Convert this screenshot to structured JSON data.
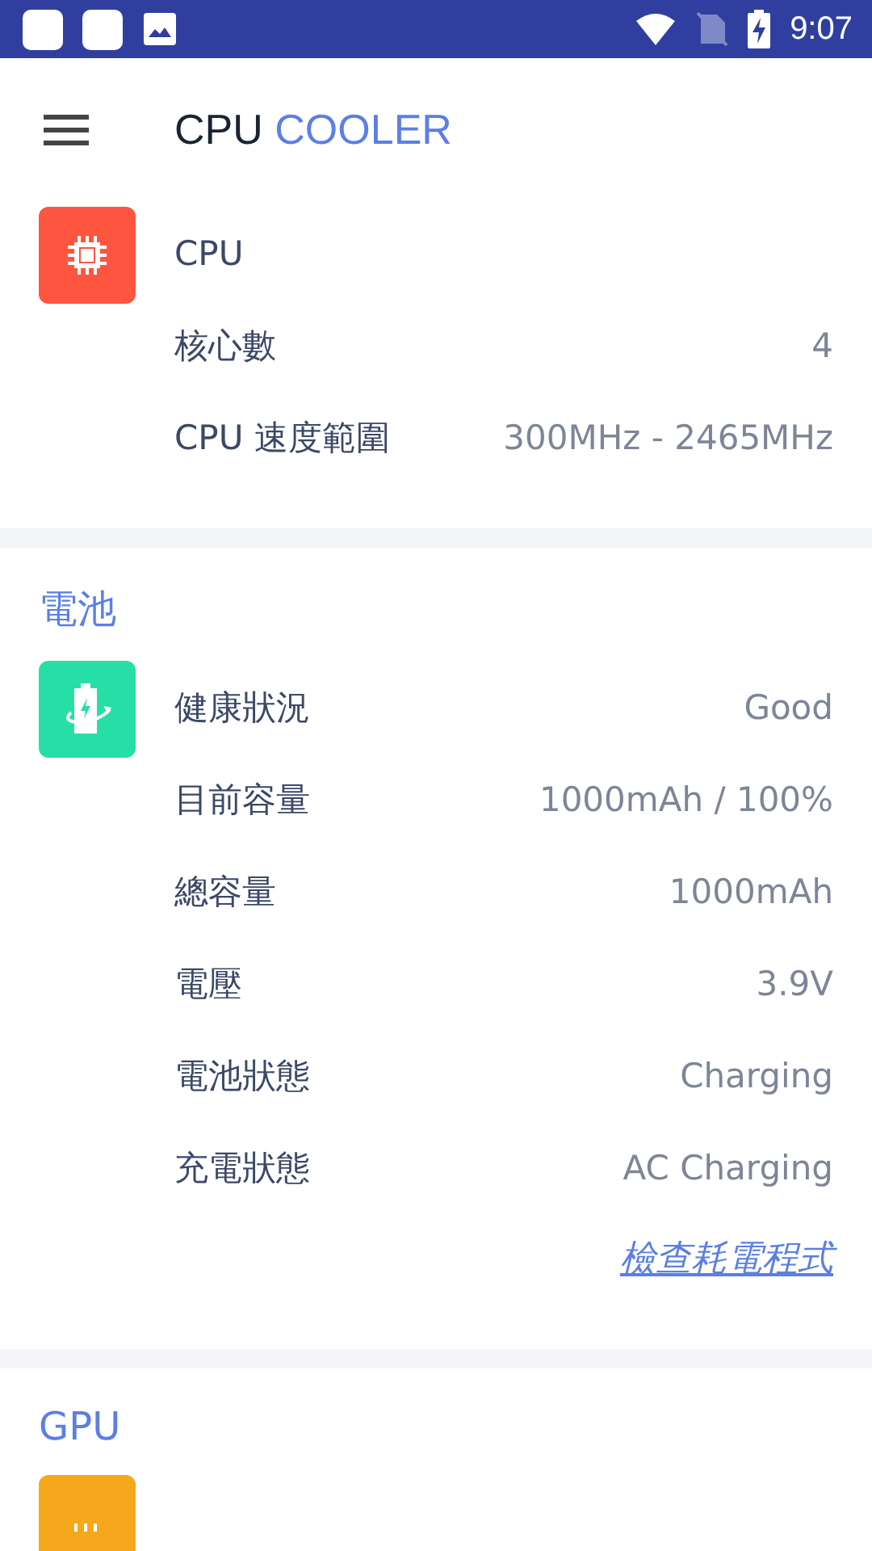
{
  "status_bar": {
    "time": "9:07"
  },
  "toolbar": {
    "title_main": "CPU",
    "title_accent": "COOLER"
  },
  "sections": [
    {
      "kind": "chip",
      "rows": [
        {
          "label": "CPU"
        },
        {
          "label": "核心數",
          "value": "4"
        },
        {
          "label": "CPU 速度範圍",
          "value": "300MHz - 2465MHz"
        }
      ]
    },
    {
      "heading": "電池",
      "kind": "battery",
      "rows": [
        {
          "label": "健康狀況",
          "value": "Good"
        },
        {
          "label": "目前容量",
          "value": "1000mAh / 100%"
        },
        {
          "label": "總容量",
          "value": "1000mAh"
        },
        {
          "label": "電壓",
          "value": "3.9V"
        },
        {
          "label": "電池狀態",
          "value": "Charging"
        },
        {
          "label": "充電狀態",
          "value": "AC Charging"
        }
      ],
      "link": "檢查耗電程式"
    },
    {
      "heading": "GPU",
      "kind": "gpu"
    }
  ]
}
